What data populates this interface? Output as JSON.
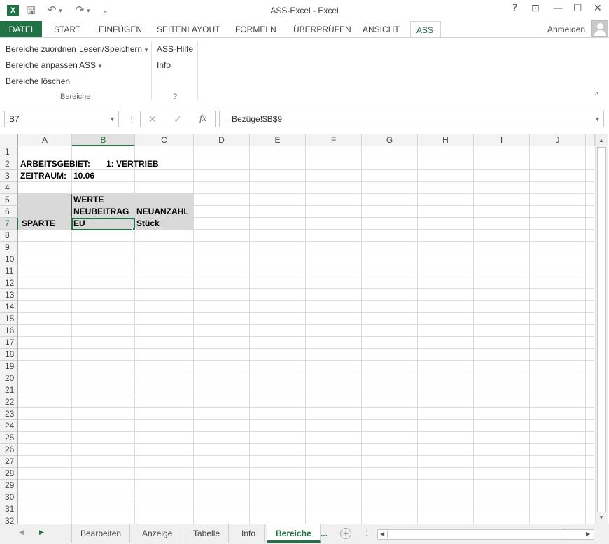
{
  "window": {
    "title": "ASS-Excel - Excel",
    "help": "?",
    "restore_ribbon": "⊡",
    "minimize": "—",
    "maximize": "☐",
    "close": "✕"
  },
  "qat": {
    "save": "🖫",
    "undo": "↶",
    "redo": "↷",
    "more": "⌄"
  },
  "ribbon_tabs": [
    "DATEI",
    "START",
    "EINFÜGEN",
    "SEITENLAYOUT",
    "FORMELN",
    "ÜBERPRÜFEN",
    "ANSICHT",
    "ASS"
  ],
  "active_tab": "ASS",
  "user": {
    "signin_label": "Anmelden"
  },
  "ribbon": {
    "group_bereiche": {
      "label": "Bereiche",
      "items": [
        "Bereiche zuordnen",
        "Bereiche anpassen",
        "Bereiche löschen"
      ],
      "dropdowns": [
        "Lesen/Speichern",
        "ASS"
      ]
    },
    "group_help": {
      "label": "?",
      "items": [
        "ASS-Hilfe",
        "Info"
      ]
    },
    "collapse_icon": "^"
  },
  "formula_bar": {
    "name_box": "B7",
    "cancel": "✕",
    "enter": "✓",
    "fx": "fx",
    "formula": "=Bezüge!$B$9"
  },
  "columns": [
    "A",
    "B",
    "C",
    "D",
    "E",
    "F",
    "G",
    "H",
    "I",
    "J"
  ],
  "selected_column": "B",
  "rows": [
    "1",
    "2",
    "3",
    "4",
    "5",
    "6",
    "7",
    "8",
    "9",
    "10",
    "11",
    "12",
    "13",
    "14",
    "15",
    "16",
    "17",
    "18",
    "19",
    "20",
    "21",
    "22",
    "23",
    "24",
    "25",
    "26",
    "27",
    "28",
    "29",
    "30",
    "31",
    "32"
  ],
  "selected_row": "7",
  "cells": {
    "A2": "ARBEITSGEBIET:",
    "B2": "1: VERTRIEB",
    "A3": "ZEITRAUM:",
    "B3": "10.06",
    "B5": "WERTE",
    "B6": "NEUBEITRAG",
    "C6": "NEUANZAHL",
    "A7": "SPARTE",
    "B7": "EU",
    "C7": "Stück"
  },
  "sheets": [
    "Bearbeiten",
    "Anzeige",
    "Tabelle",
    "Info",
    "Bereiche",
    "..."
  ],
  "active_sheet": "Bereiche",
  "colors": {
    "accent": "#217346",
    "pivot_header": "#d9d9d9"
  }
}
